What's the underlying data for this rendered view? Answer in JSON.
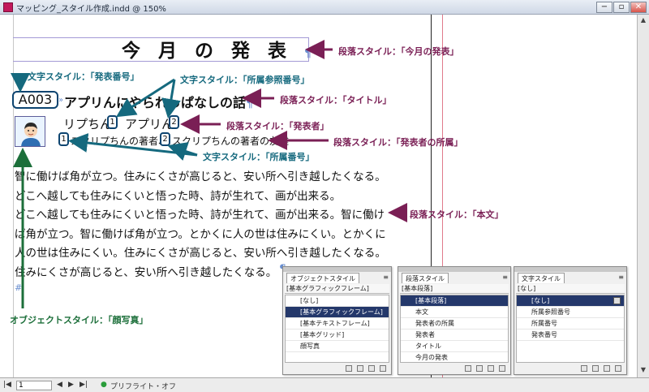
{
  "window": {
    "title": "マッピング_スタイル作成.indd @ 150%",
    "min": "−",
    "max": "▫",
    "close": "✕"
  },
  "document": {
    "heading": "今月の発表",
    "pilcrow": "¶",
    "code": "A003",
    "title": "アプリんにやられっぱなしの話",
    "speaker1": "リプちん",
    "speaker2": "アプリん",
    "ref1": "1",
    "ref2": "2",
    "affil1": "スクリプちんの著者、",
    "affil2": "スクリプちんの著者の友達",
    "body_lines": [
      "智に働けば角が立つ。住みにくさが高じると、安い所へ引き越したくなる。",
      "どこへ越しても住みにくいと悟った時、詩が生れて、画が出来る。",
      "どこへ越しても住みにくいと悟った時、詩が生れて、画が出来る。智に働け",
      "ば角が立つ。智に働けば角が立つ。とかくに人の世は住みにくい。とかくに",
      "人の世は住みにくい。住みにくさが高じると、安い所へ引き越したくなる。",
      "住みにくさが高じると、安い所へ引き越したくなる。"
    ],
    "hash_mark": "#"
  },
  "annotations": {
    "heading": "段落スタイル：「今月の発表」",
    "title": "段落スタイル：「タイトル」",
    "speaker": "段落スタイル：「発表者」",
    "affiliation": "段落スタイル：「発表者の所属」",
    "body": "段落スタイル：「本文」",
    "code_char": "文字スタイル：「発表番号」",
    "ref_char": "文字スタイル：「所属参照番号」",
    "affil_num": "文字スタイル：「所属番号」",
    "object": "オブジェクトスタイル：「顔写真」"
  },
  "colors": {
    "purple": "#7a1f55",
    "teal": "#15697e",
    "green": "#1c6f3a"
  },
  "panels": {
    "object": {
      "tab": "オブジェクトスタイル",
      "current": "[基本グラフィックフレーム]",
      "items": [
        "[なし]",
        "[基本グラフィックフレーム]",
        "[基本テキストフレーム]",
        "[基本グリッド]",
        "顔写真"
      ],
      "selected": 1
    },
    "paragraph": {
      "tab": "段落スタイル",
      "current": "[基本段落]",
      "items": [
        "[基本段落]",
        "本文",
        "発表者の所属",
        "発表者",
        "タイトル",
        "今月の発表"
      ],
      "selected": 0
    },
    "character": {
      "tab": "文字スタイル",
      "current": "[なし]",
      "items": [
        "[なし]",
        "所属参照番号",
        "所属番号",
        "発表番号"
      ],
      "selected": 0
    }
  },
  "statusbar": {
    "page": "1",
    "preflight": "プリフライト・オフ",
    "nav_first": "|◀",
    "nav_prev": "◀",
    "nav_next": "▶",
    "nav_last": "▶|"
  }
}
